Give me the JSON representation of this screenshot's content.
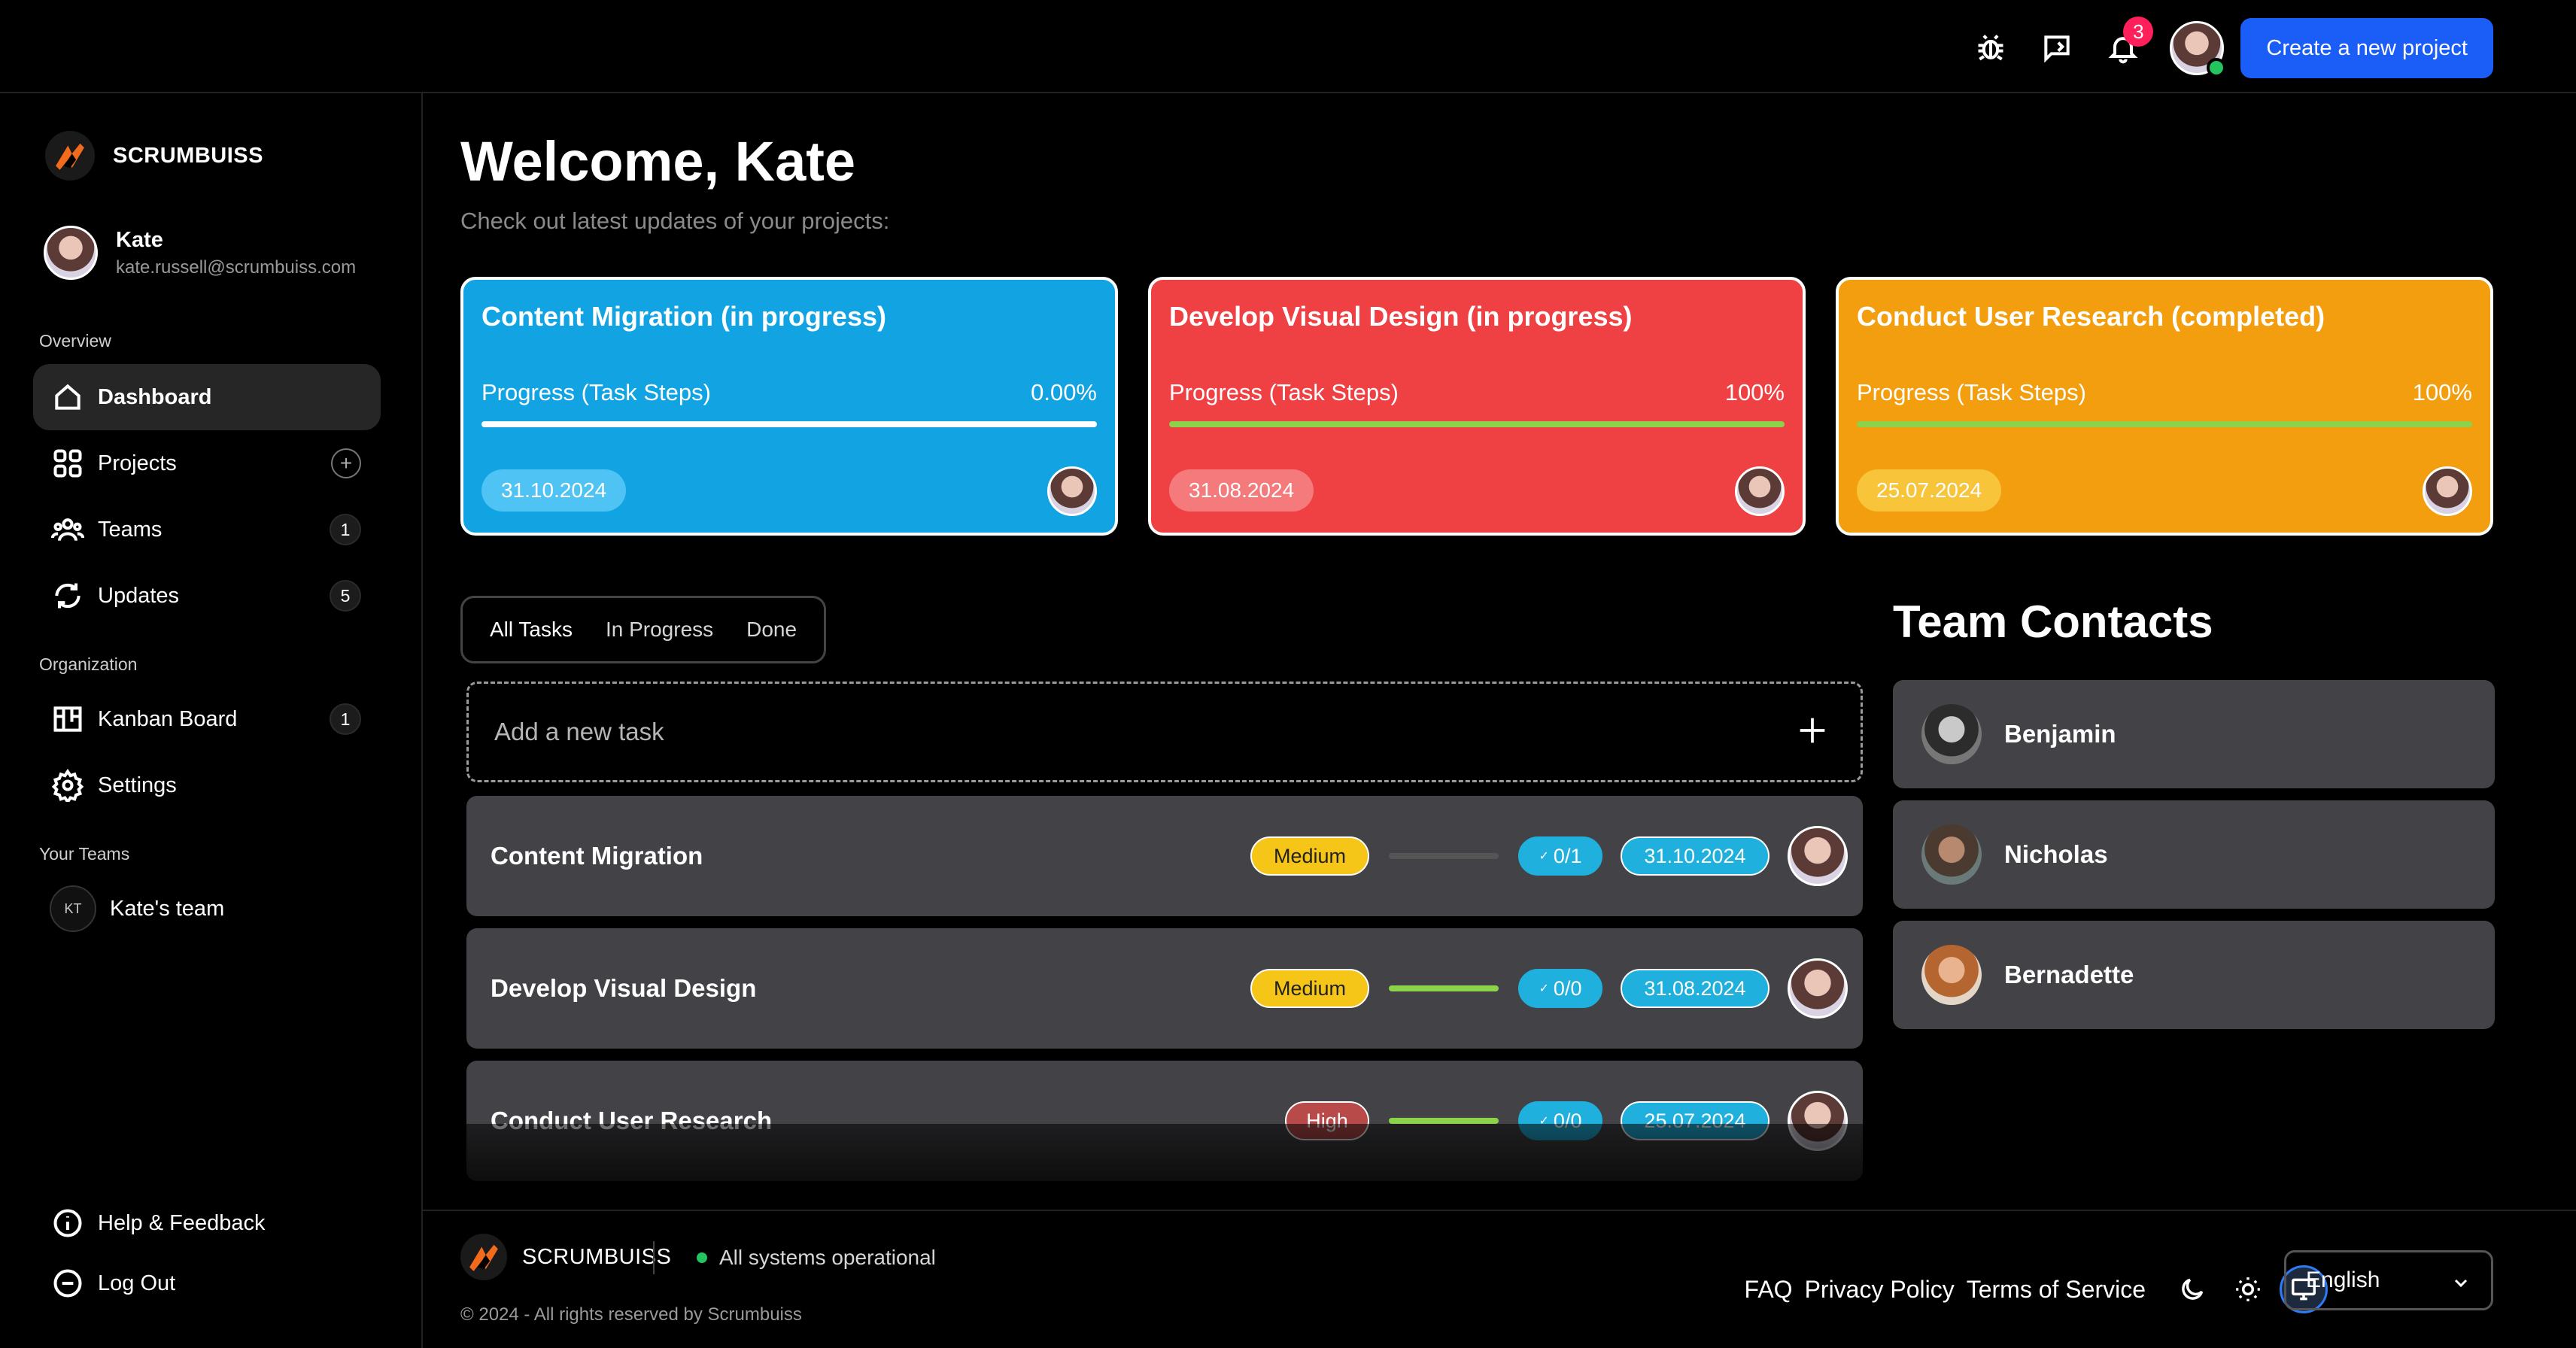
{
  "topbar": {
    "notification_count": "3",
    "create_button": "Create a new project"
  },
  "sidebar": {
    "brand": "SCRUMBUISS",
    "user": {
      "name": "Kate",
      "email": "kate.russell@scrumbuiss.com"
    },
    "overview_label": "Overview",
    "overview_items": [
      {
        "label": "Dashboard",
        "icon": "home-icon"
      },
      {
        "label": "Projects",
        "icon": "grid-icon"
      },
      {
        "label": "Teams",
        "icon": "users-icon",
        "count": "1"
      },
      {
        "label": "Updates",
        "icon": "refresh-icon",
        "count": "5"
      }
    ],
    "organization_label": "Organization",
    "organization_items": [
      {
        "label": "Kanban Board",
        "icon": "kanban-icon",
        "count": "1"
      },
      {
        "label": "Settings",
        "icon": "gear-icon"
      }
    ],
    "your_teams_label": "Your Teams",
    "team": {
      "initials": "KT",
      "name": "Kate's team"
    },
    "bottom_items": [
      {
        "label": "Help & Feedback",
        "icon": "info-icon"
      },
      {
        "label": "Log Out",
        "icon": "logout-icon"
      }
    ]
  },
  "main": {
    "welcome": "Welcome, Kate",
    "subtitle": "Check out latest updates of your projects:",
    "projects": [
      {
        "title": "Content Migration (in progress)",
        "progress_label": "Progress (Task Steps)",
        "progress_value": "0.00%",
        "progress": 0,
        "date": "31.10.2024",
        "color": "#12a3e3",
        "date_bg": "#4fc3f3"
      },
      {
        "title": "Develop Visual Design (in progress)",
        "progress_label": "Progress (Task Steps)",
        "progress_value": "100%",
        "progress": 100,
        "date": "31.08.2024",
        "color": "#ef4044",
        "date_bg": "#f47a7c"
      },
      {
        "title": "Conduct User Research (completed)",
        "progress_label": "Progress (Task Steps)",
        "progress_value": "100%",
        "progress": 100,
        "date": "25.07.2024",
        "color": "#f29e0e",
        "date_bg": "#f7c43a"
      }
    ],
    "tabs": [
      "All Tasks",
      "In Progress",
      "Done"
    ],
    "add_task_placeholder": "Add a new task",
    "tasks": [
      {
        "name": "Content Migration",
        "priority": "Medium",
        "progress": 0,
        "steps": "0/1",
        "due": "31.10.2024"
      },
      {
        "name": "Develop Visual Design",
        "priority": "Medium",
        "progress": 100,
        "steps": "0/0",
        "due": "31.08.2024"
      },
      {
        "name": "Conduct User Research",
        "priority": "High",
        "progress": 100,
        "steps": "0/0",
        "due": "25.07.2024"
      }
    ],
    "contacts_title": "Team Contacts",
    "contacts": [
      {
        "name": "Benjamin"
      },
      {
        "name": "Nicholas"
      },
      {
        "name": "Bernadette"
      }
    ]
  },
  "footer": {
    "brand": "SCRUMBUISS",
    "status": "All systems operational",
    "copyright": "© 2024 - All rights reserved by Scrumbuiss",
    "links": [
      "FAQ",
      "Privacy Policy",
      "Terms of Service"
    ],
    "language": "English"
  }
}
